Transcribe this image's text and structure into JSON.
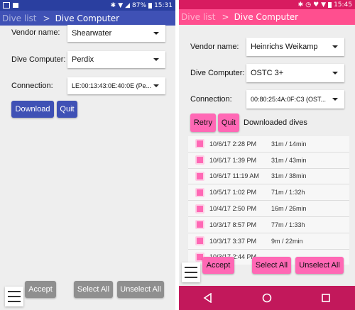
{
  "left": {
    "status": {
      "battery": "87%",
      "time": "15:31"
    },
    "breadcrumb": {
      "parent": "Dive list",
      "separator": ">",
      "current": "Dive Computer"
    },
    "vendor": {
      "label": "Vendor name:",
      "value": "Shearwater"
    },
    "computer": {
      "label": "Dive Computer:",
      "value": "Perdix"
    },
    "connection": {
      "label": "Connection:",
      "value": "LE:00:13:43:0E:40:0E (Pe..."
    },
    "buttons": {
      "download": "Download",
      "quit": "Quit",
      "accept": "Accept",
      "select_all": "Select All",
      "unselect_all": "Unselect All"
    }
  },
  "right": {
    "status": {
      "time": "15:45"
    },
    "breadcrumb": {
      "parent": "Dive list",
      "separator": ">",
      "current": "Dive Computer"
    },
    "vendor": {
      "label": "Vendor name:",
      "value": "Heinrichs Weikamp"
    },
    "computer": {
      "label": "Dive Computer:",
      "value": "OSTC 3+"
    },
    "connection": {
      "label": "Connection:",
      "value": "00:80:25:4A:0F:C3 (OST..."
    },
    "buttons": {
      "retry": "Retry",
      "quit": "Quit",
      "accept": "Accept",
      "select_all": "Select All",
      "unselect_all": "Unselect All"
    },
    "downloaded_label": "Downloaded dives",
    "dives": [
      {
        "date": "10/6/17 2:28 PM",
        "info": "31m / 14min"
      },
      {
        "date": "10/6/17 1:39 PM",
        "info": "31m / 43min"
      },
      {
        "date": "10/6/17 11:19 AM",
        "info": "31m / 38min"
      },
      {
        "date": "10/5/17 1:02 PM",
        "info": "71m / 1:32h"
      },
      {
        "date": "10/4/17 2:50 PM",
        "info": "16m / 26min"
      },
      {
        "date": "10/3/17 8:57 PM",
        "info": "77m / 1:33h"
      },
      {
        "date": "10/3/17 3:37 PM",
        "info": "9m / 22min"
      },
      {
        "date": "10/3/17 2:44 PM",
        "info": ""
      }
    ]
  },
  "colors": {
    "left_primary": "#3f51b5",
    "right_primary": "#ff4f8f",
    "right_accent": "#ff68b5",
    "right_nav": "#c2185b"
  }
}
